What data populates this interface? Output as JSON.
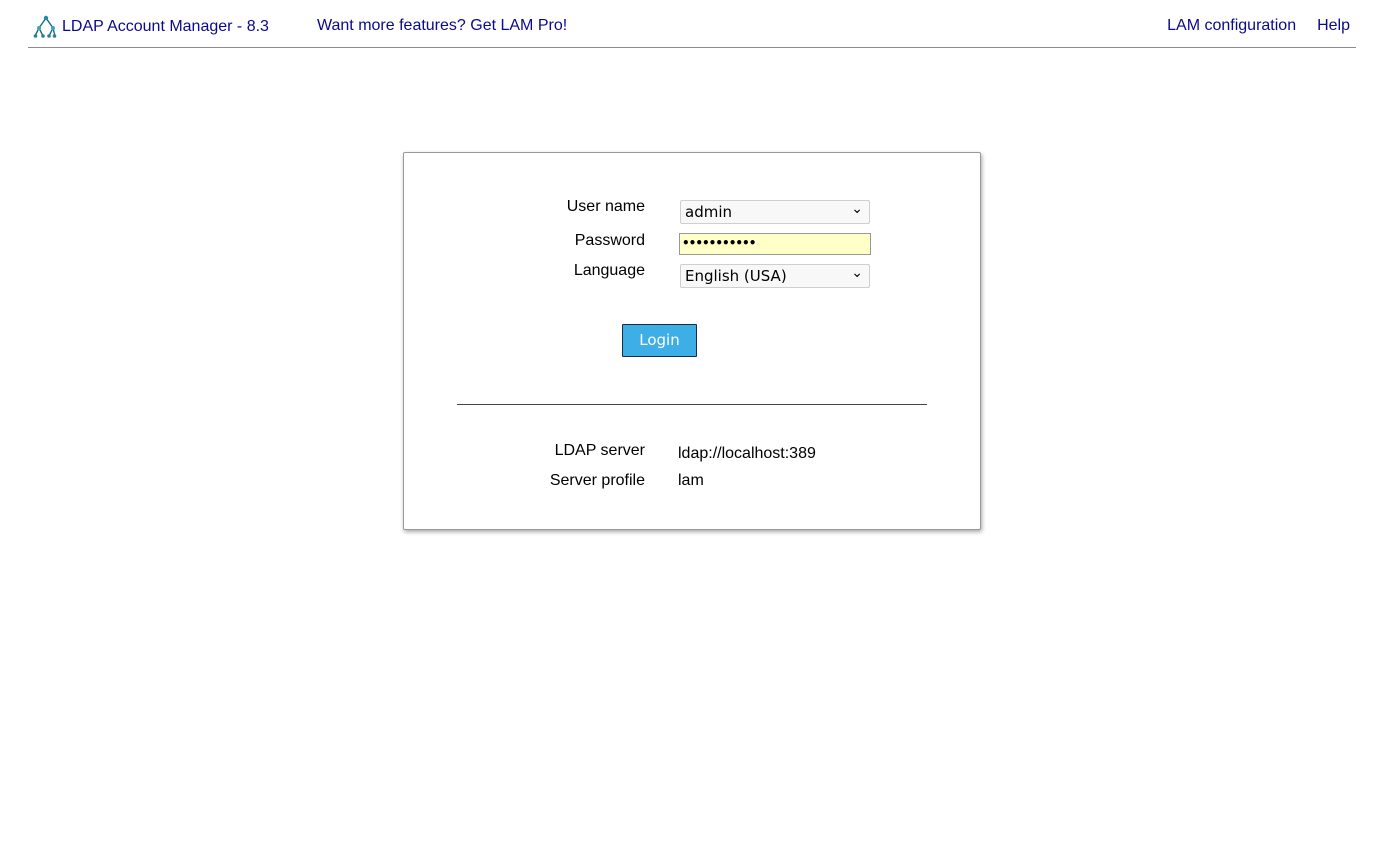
{
  "header": {
    "app_title": "LDAP Account Manager - 8.3",
    "promo_link": "Want more features? Get LAM Pro!",
    "config_link": "LAM configuration",
    "help_link": "Help",
    "logo_icon": "ldap-tree-icon",
    "link_color": "#0a0a8c"
  },
  "login": {
    "username_label": "User name",
    "username_value": "admin",
    "password_label": "Password",
    "password_value": "•••••••••••",
    "language_label": "Language",
    "language_value": "English (USA)",
    "login_button": "Login",
    "button_color": "#3eaee6",
    "password_field_color": "#ffffc8"
  },
  "server_info": {
    "server_label": "LDAP server",
    "server_value": "ldap://localhost:389",
    "profile_label": "Server profile",
    "profile_value": "lam"
  }
}
